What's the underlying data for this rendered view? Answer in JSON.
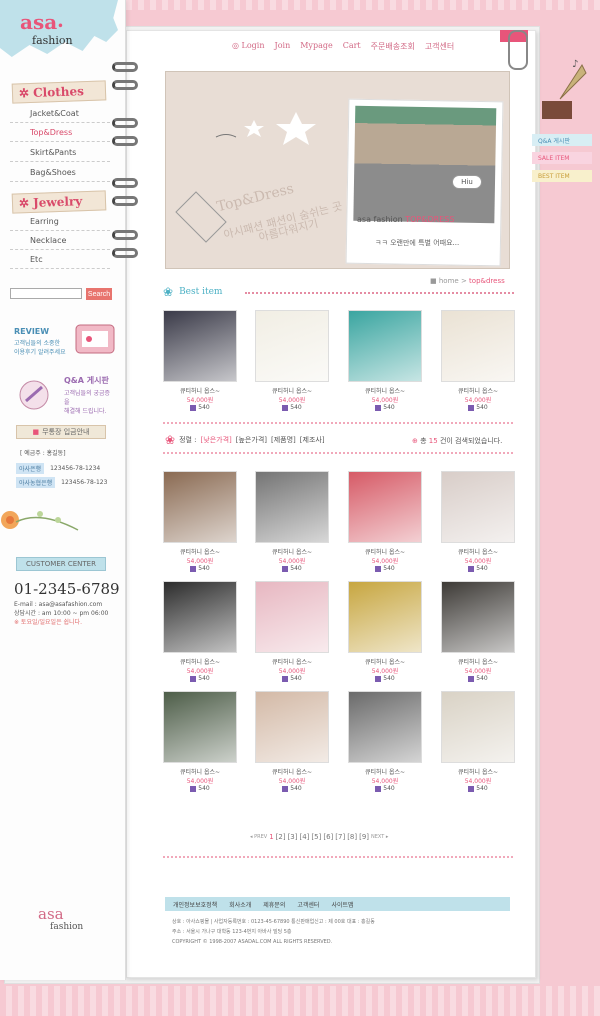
{
  "logo": {
    "main": "asa",
    "sub": "fashion"
  },
  "menu": {
    "cat1": "Clothes",
    "cat1_items": [
      "Jacket&Coat",
      "Top&Dress",
      "Skirt&Pants",
      "Bag&Shoes"
    ],
    "cat2": "Jewelry",
    "cat2_items": [
      "Earring",
      "Necklace",
      "Etc"
    ]
  },
  "search": {
    "button": "Search",
    "value": ""
  },
  "review": {
    "title": "REVIEW",
    "desc1": "고객님들의 소중한",
    "desc2": "이용후기 알려주세요"
  },
  "qa": {
    "title": "Q&A 게시판",
    "desc1": "고객님들의 궁금증을",
    "desc2": "해결해 드립니다."
  },
  "bank": {
    "title": "무통장 입금안내",
    "holder": "[ 예금주 : 홍길동]",
    "accounts": [
      {
        "bank": "아사은행",
        "number": "123456-78-1234"
      },
      {
        "bank": "아사농협은행",
        "number": "123456-78-123"
      }
    ]
  },
  "customer": {
    "title": "CUSTOMER CENTER",
    "phone": "01-2345-6789",
    "email": "E-mail : asa@asafashion.com",
    "hours": "상담시간 : am 10:00 ~ pm 06:00",
    "note": "※ 토요일/일요일은 쉽니다."
  },
  "bottom_logo": {
    "main": "asa",
    "sub": "fashion"
  },
  "topnav": [
    "Login",
    "Join",
    "Mypage",
    "Cart",
    "주문배송조회",
    "고객센터"
  ],
  "banner": {
    "title": "Top&Dress",
    "sub1": "아시패션 패션이 숨쉬는 곳",
    "sub2": "아름다워지기",
    "asa": "asa fashion",
    "asa_tag": "TOP&DRESS",
    "caption": "ㅋㅋ 오랜만에 특별 어때요...",
    "hiu": "Hiu"
  },
  "right_tabs": [
    "Q&A 게시판",
    "SALE ITEM",
    "BEST ITEM"
  ],
  "breadcrumb": {
    "home": "home",
    "current": "top&dress"
  },
  "best": {
    "title": "Best item"
  },
  "products_best": [
    {
      "name": "큐티허니 옵스~",
      "price": "54,000원",
      "pts": "540",
      "color": "#3a3a48"
    },
    {
      "name": "큐티허니 옵스~",
      "price": "54,000원",
      "pts": "540",
      "color": "#f1eee4"
    },
    {
      "name": "큐티허니 옵스~",
      "price": "54,000원",
      "pts": "540",
      "color": "#3aa5a0"
    },
    {
      "name": "큐티허니 옵스~",
      "price": "54,000원",
      "pts": "540",
      "color": "#eae2d4"
    }
  ],
  "sort": {
    "label": "정렬 :",
    "opts": [
      "[낮은가격]",
      "[높은가격]",
      "[제품명]",
      "[제조사]"
    ]
  },
  "count": {
    "pre": "총",
    "num": "15",
    "post": "건이 검색되었습니다."
  },
  "products": [
    {
      "name": "큐티허니 옵스~",
      "price": "54,000원",
      "pts": "540",
      "color": "#8a6a52"
    },
    {
      "name": "큐티허니 옵스~",
      "price": "54,000원",
      "pts": "540",
      "color": "#747474"
    },
    {
      "name": "큐티허니 옵스~",
      "price": "54,000원",
      "pts": "540",
      "color": "#d65a66"
    },
    {
      "name": "큐티허니 옵스~",
      "price": "54,000원",
      "pts": "540",
      "color": "#d8cdc8"
    },
    {
      "name": "큐티허니 옵스~",
      "price": "54,000원",
      "pts": "540",
      "color": "#2c2c2c"
    },
    {
      "name": "큐티허니 옵스~",
      "price": "54,000원",
      "pts": "540",
      "color": "#e7b7c1"
    },
    {
      "name": "큐티허니 옵스~",
      "price": "54,000원",
      "pts": "540",
      "color": "#c7a640"
    },
    {
      "name": "큐티허니 옵스~",
      "price": "54,000원",
      "pts": "540",
      "color": "#3d3a36"
    },
    {
      "name": "큐티허니 옵스~",
      "price": "54,000원",
      "pts": "540",
      "color": "#4d5d48"
    },
    {
      "name": "큐티허니 옵스~",
      "price": "54,000원",
      "pts": "540",
      "color": "#d3b9a6"
    },
    {
      "name": "큐티허니 옵스~",
      "price": "54,000원",
      "pts": "540",
      "color": "#6a6a6a"
    },
    {
      "name": "큐티허니 옵스~",
      "price": "54,000원",
      "pts": "540",
      "color": "#d9d2c5"
    }
  ],
  "pagination": {
    "prev": "PREV",
    "pages": [
      "1",
      "[2]",
      "[3]",
      "[4]",
      "[5]",
      "[6]",
      "[7]",
      "[8]",
      "[9]"
    ],
    "next": "NEXT"
  },
  "footer": {
    "links": [
      "개인정보보호정책",
      "회사소개",
      "제휴문의",
      "고객센터",
      "사이트맵"
    ],
    "line1": "상호 : 아사쇼핑몰  |  사업자등록번호 : 0123-45-67890  통신판매업신고 : 제 00호 대표 : 홍길동",
    "line2": "주소 : 서울시 가나구 대학동 123-4번지 아바사 빌딩 5층",
    "line3": "COPYRIGHT © 1998-2007 ASADAL.COM ALL RIGHTS RESERVED."
  },
  "colors": {
    "accent": "#e8557a",
    "teal": "#4bb0c4",
    "bg": "#f6c9d2"
  }
}
